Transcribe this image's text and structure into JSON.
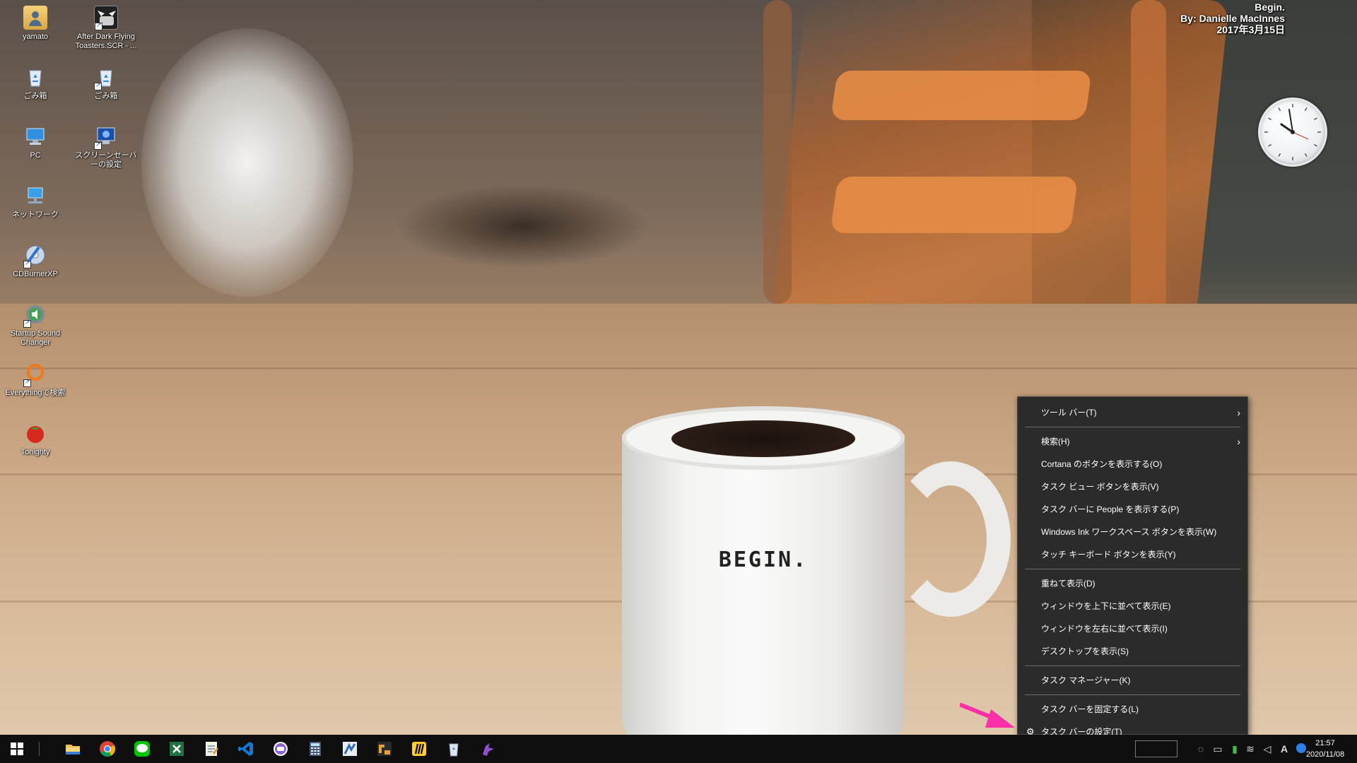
{
  "wallpaper": {
    "mug_text": "BEGIN.",
    "info_title": "Begin.",
    "info_author": "By: Danielle MacInnes",
    "info_date": "2017年3月15日"
  },
  "desktop_icons": [
    {
      "id": "yamato",
      "label": "yamato",
      "icon": "user-folder-icon"
    },
    {
      "id": "afterdark",
      "label": "After Dark Flying Toasters.SCR - ...",
      "icon": "toaster-screensaver-icon"
    },
    {
      "id": "recycle1",
      "label": "ごみ箱",
      "icon": "recycle-bin-icon"
    },
    {
      "id": "recycle2",
      "label": "ごみ箱",
      "icon": "recycle-bin-icon"
    },
    {
      "id": "pc",
      "label": "PC",
      "icon": "computer-icon"
    },
    {
      "id": "screensaver",
      "label": "スクリーンセーバーの設定",
      "icon": "screensaver-settings-icon"
    },
    {
      "id": "network",
      "label": "ネットワーク",
      "icon": "network-icon"
    },
    {
      "id": "cdburner",
      "label": "CDBurnerXP",
      "icon": "cd-burner-icon"
    },
    {
      "id": "startup",
      "label": "Startup Sound Changer",
      "icon": "sound-changer-icon"
    },
    {
      "id": "everything",
      "label": "Everythingで検索",
      "icon": "search-everything-icon"
    },
    {
      "id": "tonighty",
      "label": "Tonighty",
      "icon": "tomato-icon"
    }
  ],
  "context_menu": {
    "items": [
      {
        "label": "ツール バー(T)",
        "submenu": true,
        "arrow": "›"
      },
      {
        "separator": true
      },
      {
        "label": "検索(H)",
        "submenu": true,
        "arrow": "›"
      },
      {
        "label": "Cortana のボタンを表示する(O)"
      },
      {
        "label": "タスク ビュー ボタンを表示(V)"
      },
      {
        "label": "タスク バーに People を表示する(P)"
      },
      {
        "label": "Windows Ink ワークスペース ボタンを表示(W)"
      },
      {
        "label": "タッチ キーボード ボタンを表示(Y)"
      },
      {
        "separator": true
      },
      {
        "label": "重ねて表示(D)"
      },
      {
        "label": "ウィンドウを上下に並べて表示(E)"
      },
      {
        "label": "ウィンドウを左右に並べて表示(I)"
      },
      {
        "label": "デスクトップを表示(S)"
      },
      {
        "separator": true
      },
      {
        "label": "タスク マネージャー(K)"
      },
      {
        "separator": true
      },
      {
        "label": "タスク バーを固定する(L)"
      },
      {
        "label": "タスク バーの設定(T)",
        "gear": "⚙"
      }
    ]
  },
  "taskbar": {
    "apps": [
      {
        "name": "start-button",
        "icon": "windows-logo-icon",
        "color": "#ffffff"
      },
      {
        "name": "file-explorer",
        "icon": "folder-icon",
        "color": "#f2c14e"
      },
      {
        "name": "chrome",
        "icon": "chrome-icon",
        "color": "#db4437"
      },
      {
        "name": "line",
        "icon": "line-chat-icon",
        "color": "#00c300"
      },
      {
        "name": "excel",
        "icon": "excel-icon",
        "color": "#1f7244"
      },
      {
        "name": "notepad",
        "icon": "notepad-icon",
        "color": "#e9e3c4"
      },
      {
        "name": "vscode",
        "icon": "vscode-icon",
        "color": "#0e7ad3"
      },
      {
        "name": "chat-app",
        "icon": "chat-bubble-icon",
        "color": "#8a63d2"
      },
      {
        "name": "calculator",
        "icon": "calculator-icon",
        "color": "#4a5a7a"
      },
      {
        "name": "image-app",
        "icon": "picture-app-icon",
        "color": "#2d6db5"
      },
      {
        "name": "tool-app",
        "icon": "tool-app-icon",
        "color": "#e5a23a"
      },
      {
        "name": "miro",
        "icon": "miro-icon",
        "color": "#ffd02f"
      },
      {
        "name": "recycle-bin",
        "icon": "recycle-bin-icon",
        "color": "#9ab0c8"
      },
      {
        "name": "puzzle-app",
        "icon": "puzzle-app-icon",
        "color": "#8f4fd1"
      }
    ],
    "tray_ime": "A",
    "clock_time": "21:57",
    "clock_date": "2020/11/08"
  }
}
